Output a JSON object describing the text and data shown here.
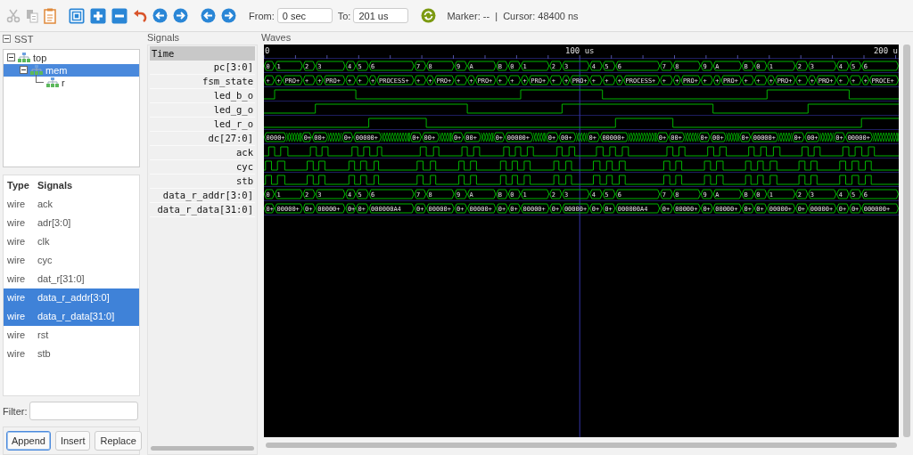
{
  "edit_buttons": [
    {
      "disabled": true
    },
    {
      "disabled": true
    },
    {
      "disabled": false
    }
  ],
  "from": {
    "label": "From:",
    "value": "0 sec"
  },
  "to": {
    "label": "To:",
    "value": "201 us"
  },
  "status": "Marker: --  |  Cursor: 48400 ns",
  "sst": {
    "title": "SST",
    "expanded": true,
    "tree": [
      {
        "label": "top",
        "expanded": true,
        "selected": false,
        "children": [
          {
            "label": "mem",
            "expanded": true,
            "selected": true,
            "children": [
              {
                "label": "r",
                "selected": false
              }
            ]
          }
        ]
      }
    ],
    "columns": [
      "Type",
      "Signals"
    ],
    "rows": [
      {
        "type": "wire",
        "name": "ack",
        "selected": false
      },
      {
        "type": "wire",
        "name": "adr[3:0]",
        "selected": false
      },
      {
        "type": "wire",
        "name": "clk",
        "selected": false
      },
      {
        "type": "wire",
        "name": "cyc",
        "selected": false
      },
      {
        "type": "wire",
        "name": "dat_r[31:0]",
        "selected": false
      },
      {
        "type": "wire",
        "name": "data_r_addr[3:0]",
        "selected": true
      },
      {
        "type": "wire",
        "name": "data_r_data[31:0]",
        "selected": true
      },
      {
        "type": "wire",
        "name": "rst",
        "selected": false
      },
      {
        "type": "wire",
        "name": "stb",
        "selected": false
      }
    ],
    "filter_label": "Filter:",
    "buttons": [
      {
        "label": "Append",
        "focused": true
      },
      {
        "label": "Insert",
        "focused": false
      },
      {
        "label": "Replace",
        "focused": false
      }
    ]
  },
  "signals": {
    "title": "Signals",
    "header": "Time",
    "names": [
      "pc[3:0]",
      "fsm_state",
      "led_b_o",
      "led_g_o",
      "led_r_o",
      "dc[27:0]",
      "ack",
      "cyc",
      "stb",
      "data_r_addr[3:0]",
      "data_r_data[31:0]"
    ]
  },
  "waves": {
    "title": "Waves",
    "ruler": [
      "0",
      "100 us",
      "200 u"
    ],
    "rows": [
      {
        "kind": "bus",
        "segments": [
          {
            "value": "0"
          },
          {
            "value": "1"
          },
          {
            "value": "2"
          },
          {
            "value": "3"
          },
          {
            "value": "4"
          },
          {
            "value": "5"
          },
          {
            "value": "6"
          },
          {
            "value": "7"
          },
          {
            "value": "8"
          },
          {
            "value": "9"
          },
          {
            "value": "A"
          },
          {
            "value": "B"
          },
          {
            "value": "0"
          },
          {
            "value": "1"
          },
          {
            "value": "2"
          },
          {
            "value": "3"
          },
          {
            "value": "4"
          },
          {
            "value": "5"
          },
          {
            "value": "6"
          },
          {
            "value": "7"
          },
          {
            "value": "8"
          },
          {
            "value": "9"
          },
          {
            "value": "A"
          },
          {
            "value": "B"
          },
          {
            "value": "0"
          },
          {
            "value": "1"
          },
          {
            "value": "2"
          },
          {
            "value": "3"
          },
          {
            "value": "4"
          },
          {
            "value": "5"
          },
          {
            "value": "6"
          }
        ]
      },
      {
        "kind": "bus",
        "segments": [
          {
            "value": "+"
          },
          {
            "value": "+"
          },
          {
            "value": "PRO+"
          },
          {
            "value": "+"
          },
          {
            "value": "+"
          },
          {
            "value": "PRO+"
          },
          {
            "value": "+"
          },
          {
            "value": "+"
          },
          {
            "value": "+"
          },
          {
            "value": "PROCESS+"
          },
          {
            "value": "+"
          },
          {
            "value": "+"
          },
          {
            "value": "PRO+"
          },
          {
            "value": "+"
          },
          {
            "value": "+"
          },
          {
            "value": "PRO+"
          },
          {
            "value": "+"
          },
          {
            "value": "+"
          },
          {
            "value": "+"
          },
          {
            "value": "PRO+"
          },
          {
            "value": "+"
          },
          {
            "value": "+"
          },
          {
            "value": "PRO+"
          },
          {
            "value": "+"
          },
          {
            "value": "+"
          },
          {
            "value": "+"
          },
          {
            "value": "PROCESS+"
          },
          {
            "value": "+"
          },
          {
            "value": "+"
          },
          {
            "value": "PRO+"
          },
          {
            "value": "+"
          },
          {
            "value": "+"
          },
          {
            "value": "PRO+"
          },
          {
            "value": "+"
          },
          {
            "value": "+"
          },
          {
            "value": "+"
          },
          {
            "value": "PRO+"
          },
          {
            "value": "+"
          },
          {
            "value": "+"
          },
          {
            "value": "PRO+"
          },
          {
            "value": "+"
          },
          {
            "value": "+"
          },
          {
            "value": "+"
          },
          {
            "value": "PROCE+"
          }
        ]
      },
      {
        "kind": "bit",
        "starts_high": false
      },
      {
        "kind": "bit",
        "starts_high": false
      },
      {
        "kind": "bit",
        "starts_high": false
      },
      {
        "kind": "bus",
        "segments": [
          {
            "kind": "value",
            "value": "0000+"
          },
          {
            "kind": "busy"
          },
          {
            "kind": "value",
            "value": "0+"
          },
          {
            "kind": "value",
            "value": "00+"
          },
          {
            "kind": "busy"
          },
          {
            "kind": "value",
            "value": "0+"
          },
          {
            "kind": "value",
            "value": "00000+"
          },
          {
            "kind": "busy"
          },
          {
            "kind": "value",
            "value": "0+"
          },
          {
            "kind": "value",
            "value": "00+"
          },
          {
            "kind": "busy"
          },
          {
            "kind": "value",
            "value": "0+"
          },
          {
            "kind": "value",
            "value": "00+"
          },
          {
            "kind": "busy"
          },
          {
            "kind": "value",
            "value": "0+"
          },
          {
            "kind": "value",
            "value": "00000+"
          },
          {
            "kind": "busy"
          },
          {
            "kind": "value",
            "value": "0+"
          },
          {
            "kind": "value",
            "value": "00+"
          },
          {
            "kind": "busy"
          },
          {
            "kind": "value",
            "value": "0+"
          },
          {
            "kind": "value",
            "value": "00000+"
          },
          {
            "kind": "busy"
          },
          {
            "kind": "value",
            "value": "0+"
          },
          {
            "kind": "value",
            "value": "00+"
          },
          {
            "kind": "busy"
          },
          {
            "kind": "value",
            "value": "0+"
          },
          {
            "kind": "value",
            "value": "00+"
          },
          {
            "kind": "busy"
          },
          {
            "kind": "value",
            "value": "0+"
          },
          {
            "kind": "value",
            "value": "00000+"
          },
          {
            "kind": "busy"
          },
          {
            "kind": "value",
            "value": "0+"
          },
          {
            "kind": "value",
            "value": "00+"
          },
          {
            "kind": "busy"
          },
          {
            "kind": "value",
            "value": "0+"
          },
          {
            "kind": "value",
            "value": "00000+"
          },
          {
            "kind": "busy"
          }
        ]
      },
      {
        "kind": "bit",
        "starts_high": false
      },
      {
        "kind": "bit",
        "starts_high": false
      },
      {
        "kind": "bit",
        "starts_high": false
      },
      {
        "kind": "bus",
        "segments": [
          {
            "value": "0"
          },
          {
            "value": "1"
          },
          {
            "value": "2"
          },
          {
            "value": "3"
          },
          {
            "value": "4"
          },
          {
            "value": "5"
          },
          {
            "value": "6"
          },
          {
            "value": "7"
          },
          {
            "value": "8"
          },
          {
            "value": "9"
          },
          {
            "value": "A"
          },
          {
            "value": "B"
          },
          {
            "value": "0"
          },
          {
            "value": "1"
          },
          {
            "value": "2"
          },
          {
            "value": "3"
          },
          {
            "value": "4"
          },
          {
            "value": "5"
          },
          {
            "value": "6"
          },
          {
            "value": "7"
          },
          {
            "value": "8"
          },
          {
            "value": "9"
          },
          {
            "value": "A"
          },
          {
            "value": "B"
          },
          {
            "value": "0"
          },
          {
            "value": "1"
          },
          {
            "value": "2"
          },
          {
            "value": "3"
          },
          {
            "value": "4"
          },
          {
            "value": "5"
          },
          {
            "value": "6"
          }
        ]
      },
      {
        "kind": "bus",
        "segments": [
          {
            "value": "0+"
          },
          {
            "value": "00000+"
          },
          {
            "value": "0+"
          },
          {
            "value": "00000+"
          },
          {
            "value": "0+"
          },
          {
            "value": "0+"
          },
          {
            "value": "000000A4"
          },
          {
            "value": "0+"
          },
          {
            "value": "00000+"
          },
          {
            "value": "0+"
          },
          {
            "value": "00000+"
          },
          {
            "value": "0+"
          },
          {
            "value": "0+"
          },
          {
            "value": "00000+"
          },
          {
            "value": "0+"
          },
          {
            "value": "00000+"
          },
          {
            "value": "0+"
          },
          {
            "value": "0+"
          },
          {
            "value": "000000A4"
          },
          {
            "value": "0+"
          },
          {
            "value": "00000+"
          },
          {
            "value": "0+"
          },
          {
            "value": "00000+"
          },
          {
            "value": "0+"
          },
          {
            "value": "0+"
          },
          {
            "value": "00000+"
          },
          {
            "value": "0+"
          },
          {
            "value": "00000+"
          },
          {
            "value": "0+"
          },
          {
            "value": "0+"
          },
          {
            "value": "000000+"
          }
        ]
      }
    ]
  }
}
